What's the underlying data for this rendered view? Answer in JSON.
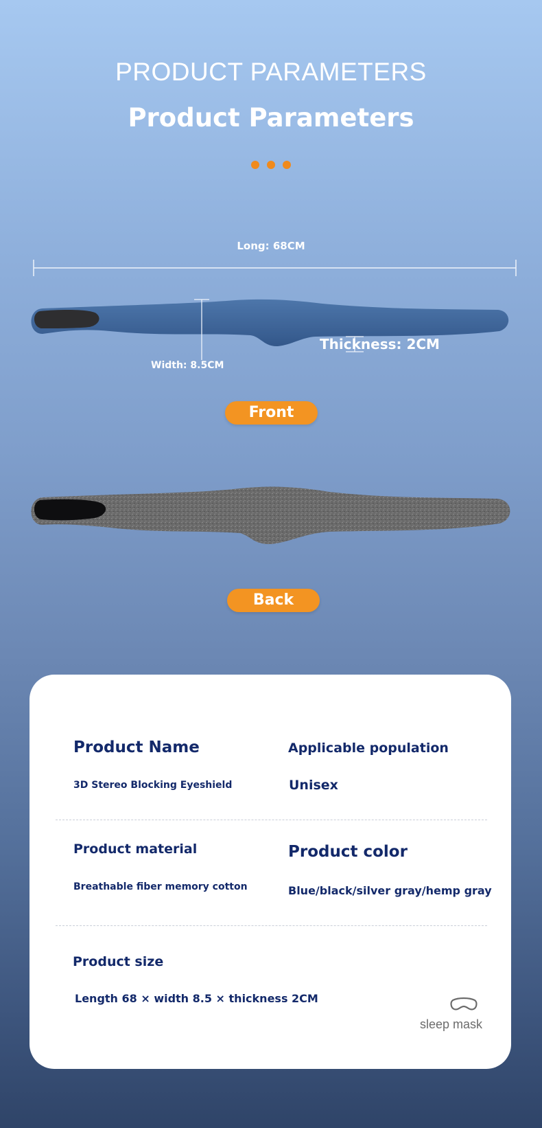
{
  "header": {
    "title_caps": "PRODUCT PARAMETERS",
    "title": "Product Parameters"
  },
  "dimensions": {
    "long": "Long: 68CM",
    "width": "Width: 8.5CM",
    "thickness": "Thickness: 2CM"
  },
  "views": {
    "front_label": "Front",
    "back_label": "Back"
  },
  "specs": {
    "product_name": {
      "label": "Product Name",
      "value": "3D Stereo Blocking Eyeshield"
    },
    "population": {
      "label": "Applicable population",
      "value": "Unisex"
    },
    "material": {
      "label": "Product material",
      "value": "Breathable fiber memory cotton"
    },
    "color": {
      "label": "Product color",
      "value": "Blue/black/silver gray/hemp gray"
    },
    "size": {
      "label": "Product size",
      "value": "Length 68 × width 8.5 × thickness 2CM"
    }
  },
  "brand": {
    "icon": "sleep-mask-icon",
    "text": "sleep mask"
  },
  "colors": {
    "accent": "#f39422",
    "navy": "#13296a",
    "front_fabric": "#3f6596",
    "back_fabric": "#666666"
  }
}
